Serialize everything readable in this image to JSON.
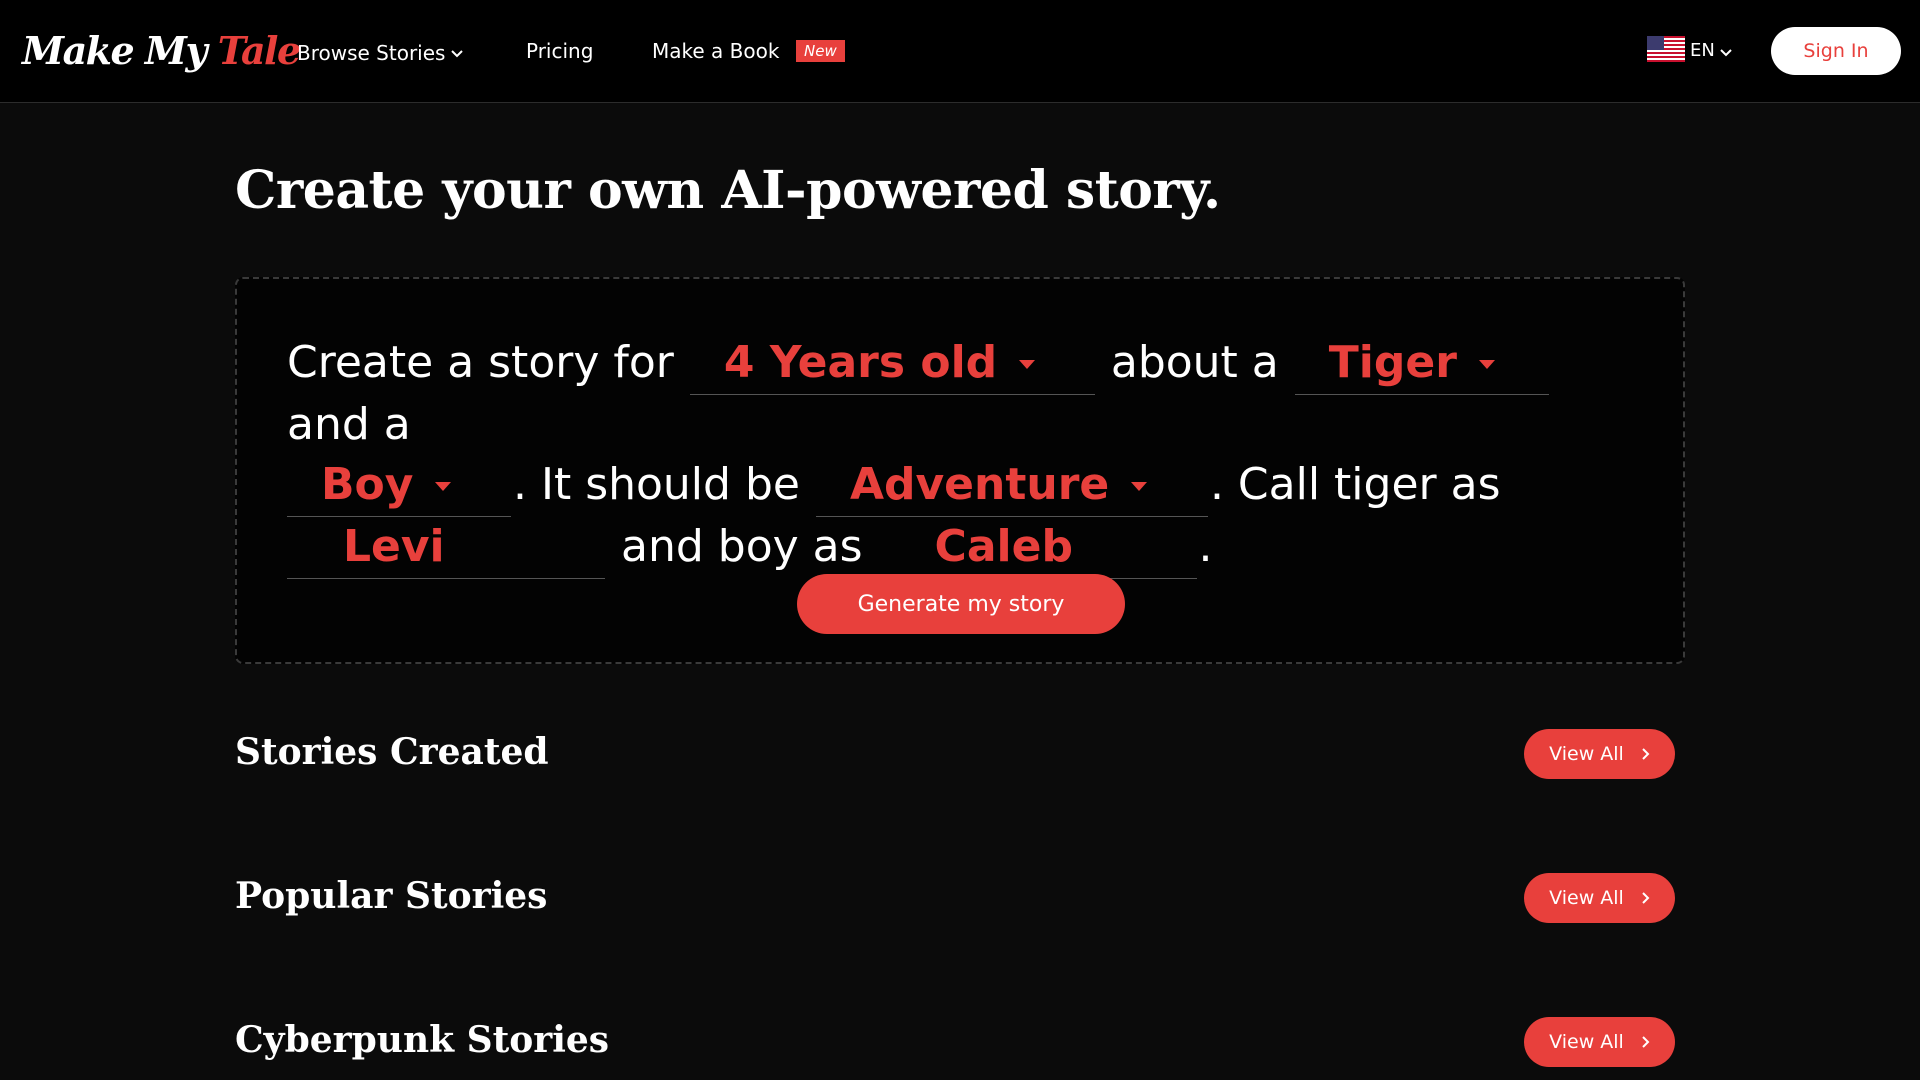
{
  "brand": {
    "logo_part1": "Make My ",
    "logo_part2": "Tale",
    "accent_color": "#e8403c"
  },
  "nav": {
    "browse_label": "Browse Stories",
    "pricing_label": "Pricing",
    "book_label": "Make a Book",
    "book_badge": "New",
    "language": "EN",
    "signin_label": "Sign In"
  },
  "hero": {
    "title": "Create your own AI-powered story."
  },
  "builder": {
    "t1": "Create a story for",
    "age": "4 Years old",
    "t2": "about a",
    "animal": "Tiger",
    "t3": "and a",
    "gender": "Boy",
    "t4": ". It should be",
    "genre": "Adventure",
    "t5": ". Call tiger as",
    "name1": "Levi",
    "t6": "and boy as",
    "name2": "Caleb",
    "t7": ".",
    "generate_label": "Generate my story"
  },
  "sections": [
    {
      "title": "Stories Created",
      "button": "View All"
    },
    {
      "title": "Popular Stories",
      "button": "View All"
    },
    {
      "title": "Cyberpunk Stories",
      "button": "View All"
    }
  ],
  "icons": {
    "browse_chevron": "chevron-down-icon",
    "lang_chevron": "chevron-down-icon",
    "flag": "us-flag-icon",
    "view_all_arrow": "chevron-right-icon"
  }
}
